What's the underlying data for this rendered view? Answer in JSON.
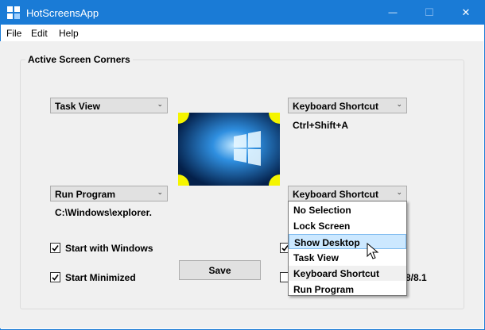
{
  "window": {
    "title": "HotScreensApp",
    "colors": {
      "titlebar": "#1a7bd6",
      "panel": "#f0f0f0",
      "selection": "#cce8ff",
      "corner_highlight": "#f5f500"
    }
  },
  "titlebar_buttons": {
    "minimize": "—",
    "maximize": "☐",
    "close": "✕"
  },
  "menu": {
    "items": [
      "File",
      "Edit",
      "Help"
    ]
  },
  "group": {
    "title": "Active Screen Corners"
  },
  "corners": {
    "top_left": {
      "selected": "Task View"
    },
    "top_right": {
      "selected": "Keyboard Shortcut",
      "shortcut": "Ctrl+Shift+A"
    },
    "bottom_left": {
      "selected": "Run Program",
      "program": "C:\\Windows\\explorer."
    },
    "bottom_right": {
      "selected": "Keyboard Shortcut"
    }
  },
  "options": {
    "start_with_windows": {
      "label": "Start with Windows",
      "checked": true
    },
    "start_minimized": {
      "label": "Start Minimized",
      "checked": true
    },
    "right_check_1": {
      "checked": true
    },
    "right_check_2": {
      "checked": false,
      "label_tail": "8/8.1"
    }
  },
  "save_button": "Save",
  "dropdown": {
    "options": [
      "No Selection",
      "Lock Screen",
      "Show Desktop",
      "Task View",
      "Keyboard Shortcut",
      "Run Program"
    ],
    "highlighted": "Show Desktop"
  }
}
